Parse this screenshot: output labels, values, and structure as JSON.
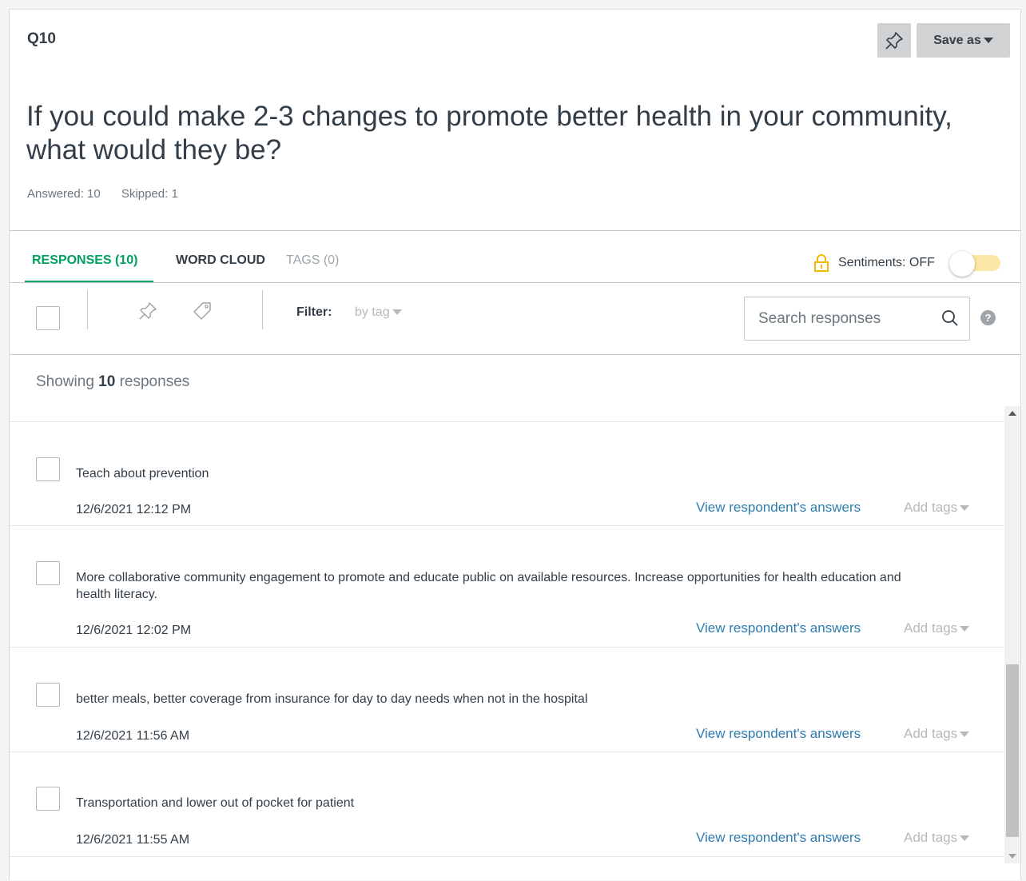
{
  "question": {
    "number": "Q10",
    "title": "If you could make 2-3 changes to promote better health in your community, what would they be?",
    "answered": "Answered: 10",
    "skipped": "Skipped: 1"
  },
  "header_buttons": {
    "pin_icon": "pin-icon",
    "save_as": "Save as"
  },
  "tabs": [
    {
      "label": "RESPONSES (10)",
      "active": true
    },
    {
      "label": "WORD CLOUD",
      "active": false
    },
    {
      "label": "TAGS (0)",
      "active": false
    }
  ],
  "sentiments": {
    "label": "Sentiments: OFF",
    "enabled": false,
    "lock_color": "#f5b800"
  },
  "toolbar": {
    "filter_label": "Filter:",
    "filter_value": "by tag",
    "search_placeholder": "Search responses",
    "help": "?"
  },
  "showing": {
    "prefix": "Showing",
    "count": "10",
    "suffix": "responses"
  },
  "responses": [
    {
      "text": "Teach about prevention",
      "date": "12/6/2021 12:12 PM",
      "view": "View respondent's answers",
      "tags": "Add tags"
    },
    {
      "text": "More collaborative community engagement to promote and educate public on available resources. Increase opportunities for health education and health literacy.",
      "date": "12/6/2021 12:02 PM",
      "view": "View respondent's answers",
      "tags": "Add tags"
    },
    {
      "text": "better meals, better coverage from insurance for day to day needs when not in the hospital",
      "date": "12/6/2021 11:56 AM",
      "view": "View respondent's answers",
      "tags": "Add tags"
    },
    {
      "text": "Transportation and lower out of pocket for patient",
      "date": "12/6/2021 11:55 AM",
      "view": "View respondent's answers",
      "tags": "Add tags"
    }
  ],
  "colors": {
    "accent_green": "#00a05e",
    "link_blue": "#2d7cb0",
    "text_dark": "#333e48",
    "button_gray": "#d0d2d3"
  }
}
